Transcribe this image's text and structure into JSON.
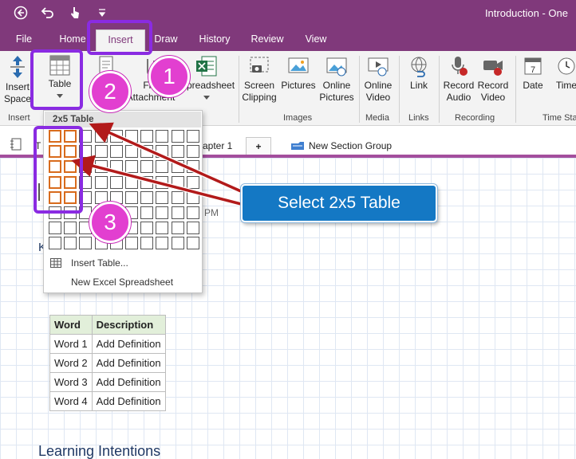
{
  "window": {
    "title": "Introduction - One"
  },
  "tabs": [
    "File",
    "Home",
    "Insert",
    "Draw",
    "History",
    "Review",
    "View"
  ],
  "active_tab": "Insert",
  "ribbon": {
    "insert_space": [
      "Insert",
      "Space"
    ],
    "table": "Table",
    "file_attachment": [
      "File",
      "Attachment"
    ],
    "spreadsheet": "Spreadsheet",
    "printout_partial": "P",
    "screen_clipping": [
      "Screen",
      "Clipping"
    ],
    "pictures": "Pictures",
    "online_pictures": [
      "Online",
      "Pictures"
    ],
    "online_video": [
      "Online",
      "Video"
    ],
    "link": "Link",
    "record_audio": [
      "Record",
      "Audio"
    ],
    "record_video": [
      "Record",
      "Video"
    ],
    "date": "Date",
    "time": "Time",
    "groups": {
      "insert": "Insert",
      "images": "Images",
      "media": "Media",
      "links": "Links",
      "recording": "Recording",
      "time_stamp": "Time Sta"
    }
  },
  "sections": {
    "chapter": "apter 1",
    "add": "+",
    "new_group": "New Section Group",
    "left_partial": "T"
  },
  "table_dropdown": {
    "title": "2x5 Table",
    "cols": 10,
    "rows": 8,
    "selected_cols": 2,
    "selected_rows": 5,
    "insert_table": "Insert Table...",
    "new_excel": "New Excel Spreadsheet"
  },
  "page_text": {
    "partial_k": "K",
    "partial_time": "PM",
    "heading": "Learning Intentions"
  },
  "note_table": {
    "headers": [
      "Word",
      "Description"
    ],
    "rows": [
      [
        "Word 1",
        "Add Definition"
      ],
      [
        "Word 2",
        "Add Definition"
      ],
      [
        "Word 3",
        "Add Definition"
      ],
      [
        "Word 4",
        "Add Definition"
      ]
    ]
  },
  "annotations": {
    "step1": "1",
    "step2": "2",
    "step3": "3",
    "callout": "Select 2x5 Table"
  },
  "colors": {
    "accent": "#80397b",
    "annotation_purple": "#8a2be2",
    "step_circle": "#e23fd0",
    "callout_blue": "#1478c4",
    "selection": "#d86b1c"
  }
}
